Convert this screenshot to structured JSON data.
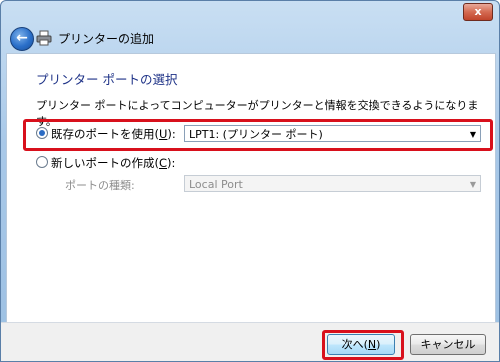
{
  "window": {
    "title": "プリンターの追加",
    "close_label": "x"
  },
  "main": {
    "heading": "プリンター ポートの選択",
    "description": "プリンター ポートによってコンピューターがプリンターと情報を交換できるようになります。",
    "option_existing": {
      "label_prefix": "既存のポートを使用(",
      "mnemonic": "U",
      "label_suffix": "):",
      "selected": true,
      "value": "LPT1: (プリンター ポート)"
    },
    "option_new": {
      "label_prefix": "新しいポートの作成(",
      "mnemonic": "C",
      "label_suffix": "):",
      "selected": false,
      "port_type_label": "ポートの種類:",
      "port_type_value": "Local Port"
    }
  },
  "footer": {
    "next_prefix": "次へ(",
    "next_mnemonic": "N",
    "next_suffix": ")",
    "cancel_label": "キャンセル"
  },
  "colors": {
    "highlight_box": "#d8101c",
    "heading": "#1e3287"
  },
  "icons": {
    "back": "back-arrow-icon",
    "printer": "printer-icon",
    "close": "close-icon"
  }
}
